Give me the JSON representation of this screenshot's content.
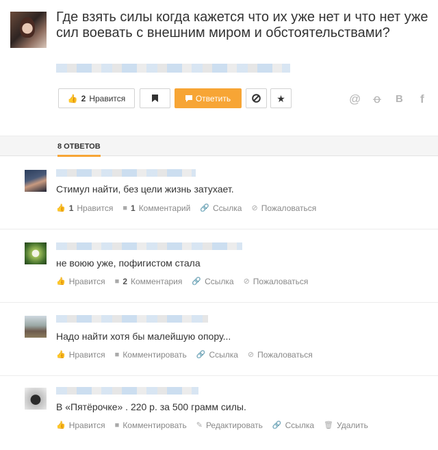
{
  "question": {
    "title": "Где взять силы когда кажется что их уже нет и что нет уже сил воевать с внешним миром и обстоятельствами?",
    "like_count": "2",
    "like_label": "Нравится",
    "answer_label": "Ответить",
    "share_icons": [
      "at-icon",
      "odnoklassniki-icon",
      "vkontakte-icon",
      "facebook-icon"
    ],
    "share_glyphs": [
      "@",
      "ꝋ",
      "В",
      "f"
    ]
  },
  "tabs": {
    "answers_label": "8 ОТВЕТОВ"
  },
  "answers": [
    {
      "text": "Стимул найти, без цели жизнь затухает.",
      "like_count": "1",
      "like_label": "Нравится",
      "comment_count": "1",
      "comment_label": "Комментарий",
      "link_label": "Ссылка",
      "report_label": "Пожаловаться"
    },
    {
      "text": "не воюю уже, пофигистом стала",
      "like_label": "Нравится",
      "comment_count": "2",
      "comment_label": "Комментария",
      "link_label": "Ссылка",
      "report_label": "Пожаловаться"
    },
    {
      "text": "Надо найти хотя бы малейшую опору...",
      "like_label": "Нравится",
      "comment_label": "Комментировать",
      "link_label": "Ссылка",
      "report_label": "Пожаловаться"
    },
    {
      "text": "В «Пятёрочке» . 220 р. за 500 грамм силы.",
      "like_label": "Нравится",
      "comment_label": "Комментировать",
      "edit_label": "Редактировать",
      "link_label": "Ссылка",
      "delete_label": "Удалить"
    }
  ],
  "colors": {
    "accent": "#f7a535",
    "text": "#333333",
    "muted": "#888888"
  }
}
